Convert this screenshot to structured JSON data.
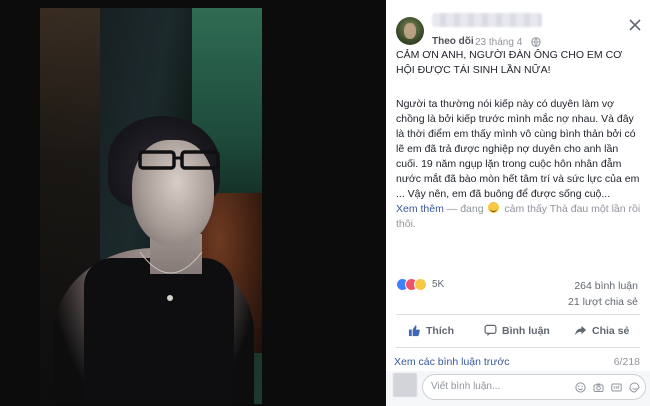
{
  "post": {
    "follow_label": "Theo dõi",
    "separator": "·",
    "date": "23 tháng 4",
    "title": "CẢM ƠN ANH, NGƯỜI ĐÀN ÔNG CHO EM CƠ HỘI ĐƯỢC TÁI SINH LẦN NỮA!",
    "body": "Người ta thường nói kiếp này có duyên làm vợ chồng là bởi kiếp trước mình mắc nợ nhau. Và đây là thời điểm em thấy mình vô cùng bình thản bởi có lẽ em đã trả được nghiệp nợ duyên cho anh lần cuối. 19 năm ngụp lặn trong cuộc hôn nhân đẫm nước mắt đã bào mòn hết tâm trí và sức lực của em ... Vậy nên, em đã buông để được sống cuộ...",
    "see_more": "Xem thêm",
    "feeling_prefix": " — đang ",
    "feeling_text": " cảm thấy Thà đau một lần rồi thôi."
  },
  "stats": {
    "reactions_count": "5K",
    "comments": "264 bình luận",
    "shares": "21 lượt chia sẻ"
  },
  "actions": {
    "like": "Thích",
    "comment": "Bình luận",
    "share": "Chia sẻ"
  },
  "comments": {
    "view_previous": "Xem các bình luận trước",
    "count": "6/218",
    "placeholder": "Viết bình luận..."
  },
  "colors": {
    "link": "#365899",
    "like_blue": "#4080ff",
    "love_red": "#f25268",
    "reaction_yellow": "#f7c844"
  }
}
